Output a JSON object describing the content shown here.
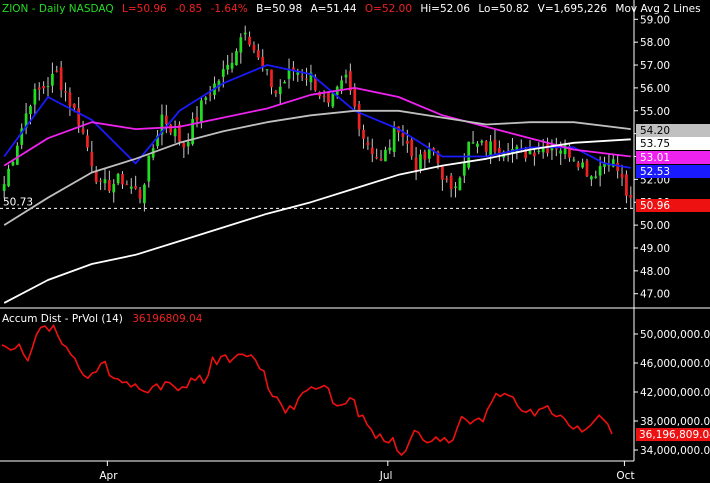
{
  "header": {
    "symbol": "ZION - Daily  NASDAQ",
    "last": "L=50.96",
    "change": "-0.85",
    "pct": "-1.64%",
    "bid": "B=50.98",
    "ask": "A=51.44",
    "open": "O=52.00",
    "high": "Hi=52.06",
    "low": "Lo=50.82",
    "volume": "V=1,695,226",
    "study": "Mov Avg 2 Lines",
    "more": "..."
  },
  "indicator": {
    "name": "Accum Dist - PrVol (14)",
    "value": "36196809.04"
  },
  "colors": {
    "background": "#000000",
    "up": "#22dd22",
    "down": "#ee2222",
    "ma_blue": "#1a1aff",
    "ma_magenta": "#ee22ee",
    "ma_gray": "#bfbfbf",
    "ma_white": "#ffffff",
    "ad_line": "#ee1111"
  },
  "chart_data": [
    {
      "type": "candlestick",
      "title": "ZION - Daily NASDAQ",
      "x_ticks": [
        "Apr",
        "Jul",
        "Oct"
      ],
      "y_ticks": [
        "47.00",
        "48.00",
        "49.00",
        "50.00",
        "51.00",
        "52.00",
        "53.00",
        "54.00",
        "55.00",
        "56.00",
        "57.00",
        "58.00",
        "59.00"
      ],
      "ylim": [
        46.2,
        59.5
      ],
      "grid": false,
      "price_flags": [
        {
          "label": "54.20",
          "value": 54.2,
          "color": "#c0c0c0"
        },
        {
          "label": "53.75",
          "value": 53.75,
          "color": "#ffffff"
        },
        {
          "label": "53.01",
          "value": 53.01,
          "color": "#ee22ee"
        },
        {
          "label": "52.53",
          "value": 52.53,
          "color": "#1a1aff"
        },
        {
          "label": "50.96",
          "value": 50.96,
          "color": "#ee1111"
        }
      ],
      "reference_line": {
        "label": "50.73",
        "value": 50.73
      },
      "close_anchors": [
        [
          0,
          51.8
        ],
        [
          6,
          55.5
        ],
        [
          12,
          56.6
        ],
        [
          17,
          54.6
        ],
        [
          22,
          51.6
        ],
        [
          27,
          52.0
        ],
        [
          31,
          51.3
        ],
        [
          36,
          54.8
        ],
        [
          41,
          53.5
        ],
        [
          46,
          55.6
        ],
        [
          51,
          56.9
        ],
        [
          55,
          58.7
        ],
        [
          58,
          57.2
        ],
        [
          62,
          55.8
        ],
        [
          66,
          56.8
        ],
        [
          70,
          56.5
        ],
        [
          74,
          55.1
        ],
        [
          78,
          56.4
        ],
        [
          82,
          53.9
        ],
        [
          86,
          52.7
        ],
        [
          90,
          54.4
        ],
        [
          94,
          52.6
        ],
        [
          98,
          53.2
        ],
        [
          102,
          51.3
        ],
        [
          106,
          53.5
        ],
        [
          110,
          53.4
        ],
        [
          114,
          53.5
        ],
        [
          118,
          53.1
        ],
        [
          122,
          53.4
        ],
        [
          126,
          53.5
        ],
        [
          130,
          53.1
        ],
        [
          134,
          52.2
        ],
        [
          138,
          53.0
        ],
        [
          140,
          52.4
        ],
        [
          143,
          50.9
        ]
      ],
      "series": [
        {
          "name": "MA blue",
          "points": [
            [
              0,
              53.0
            ],
            [
              10,
              55.6
            ],
            [
              20,
              54.6
            ],
            [
              30,
              52.7
            ],
            [
              40,
              55.0
            ],
            [
              50,
              56.2
            ],
            [
              60,
              57.0
            ],
            [
              70,
              56.6
            ],
            [
              80,
              55.0
            ],
            [
              90,
              54.2
            ],
            [
              100,
              53.0
            ],
            [
              110,
              53.0
            ],
            [
              120,
              53.4
            ],
            [
              130,
              53.4
            ],
            [
              137,
              52.7
            ],
            [
              143,
              52.5
            ]
          ]
        },
        {
          "name": "MA magenta",
          "points": [
            [
              0,
              52.6
            ],
            [
              10,
              53.8
            ],
            [
              20,
              54.5
            ],
            [
              30,
              54.2
            ],
            [
              40,
              54.3
            ],
            [
              50,
              54.7
            ],
            [
              60,
              55.1
            ],
            [
              70,
              55.7
            ],
            [
              80,
              56.0
            ],
            [
              90,
              55.6
            ],
            [
              100,
              54.8
            ],
            [
              110,
              54.3
            ],
            [
              120,
              53.8
            ],
            [
              130,
              53.3
            ],
            [
              143,
              53.0
            ]
          ]
        },
        {
          "name": "MA gray",
          "points": [
            [
              0,
              50.0
            ],
            [
              10,
              51.2
            ],
            [
              20,
              52.3
            ],
            [
              30,
              52.9
            ],
            [
              40,
              53.6
            ],
            [
              50,
              54.1
            ],
            [
              60,
              54.5
            ],
            [
              70,
              54.8
            ],
            [
              80,
              55.0
            ],
            [
              90,
              55.0
            ],
            [
              100,
              54.7
            ],
            [
              110,
              54.4
            ],
            [
              120,
              54.5
            ],
            [
              130,
              54.5
            ],
            [
              143,
              54.2
            ]
          ]
        },
        {
          "name": "MA white",
          "points": [
            [
              0,
              46.6
            ],
            [
              10,
              47.6
            ],
            [
              20,
              48.3
            ],
            [
              30,
              48.7
            ],
            [
              40,
              49.3
            ],
            [
              50,
              49.9
            ],
            [
              60,
              50.5
            ],
            [
              70,
              51.0
            ],
            [
              80,
              51.6
            ],
            [
              90,
              52.2
            ],
            [
              100,
              52.6
            ],
            [
              110,
              52.9
            ],
            [
              120,
              53.3
            ],
            [
              130,
              53.6
            ],
            [
              143,
              53.75
            ]
          ]
        }
      ]
    },
    {
      "type": "line",
      "title": "Accum Dist - PrVol (14)",
      "y_ticks": [
        "34,000,000.00",
        "38,000,000.00",
        "42,000,000.00",
        "46,000,000.00",
        "50,000,000.00"
      ],
      "ylim": [
        32000000,
        51500000
      ],
      "last_value": "36,196,809.04",
      "values": [
        48.5,
        48.2,
        47.8,
        48.0,
        48.6,
        47.2,
        46.3,
        48.0,
        49.9,
        50.9,
        51.1,
        50.4,
        51.2,
        49.8,
        48.6,
        48.2,
        47.2,
        46.6,
        45.2,
        44.3,
        43.9,
        44.6,
        44.8,
        45.9,
        46.2,
        44.3,
        43.9,
        43.8,
        43.3,
        43.4,
        42.7,
        43.1,
        42.4,
        42.1,
        41.9,
        42.7,
        43.1,
        42.3,
        43.4,
        43.3,
        42.8,
        42.2,
        42.7,
        42.6,
        43.9,
        43.6,
        44.3,
        43.2,
        44.3,
        46.8,
        45.8,
        46.9,
        47.1,
        46.1,
        46.7,
        47.2,
        47.2,
        46.9,
        47.1,
        46.4,
        45.2,
        44.9,
        42.4,
        41.4,
        41.3,
        40.3,
        39.1,
        40.1,
        39.6,
        41.1,
        41.9,
        42.2,
        42.7,
        42.4,
        42.6,
        42.9,
        42.5,
        40.5,
        40.1,
        40.2,
        40.4,
        41.2,
        40.9,
        38.6,
        38.8,
        37.5,
        36.8,
        35.6,
        36.2,
        35.2,
        35.0,
        35.7,
        33.9,
        33.3,
        33.9,
        35.4,
        36.7,
        36.4,
        35.4,
        35.0,
        35.2,
        35.8,
        35.2,
        35.7,
        35.0,
        35.4,
        37.1,
        38.6,
        38.2,
        37.6,
        38.1,
        38.4,
        37.9,
        39.6,
        40.6,
        41.8,
        41.4,
        41.8,
        41.5,
        41.3,
        40.1,
        39.4,
        39.2,
        39.6,
        38.7,
        39.6,
        39.8,
        40.1,
        39.0,
        38.6,
        38.8,
        38.3,
        37.4,
        36.9,
        37.3,
        36.5,
        36.9,
        37.4,
        38.1,
        38.8,
        38.2,
        37.6,
        36.2
      ],
      "values_unit": "millions"
    }
  ]
}
